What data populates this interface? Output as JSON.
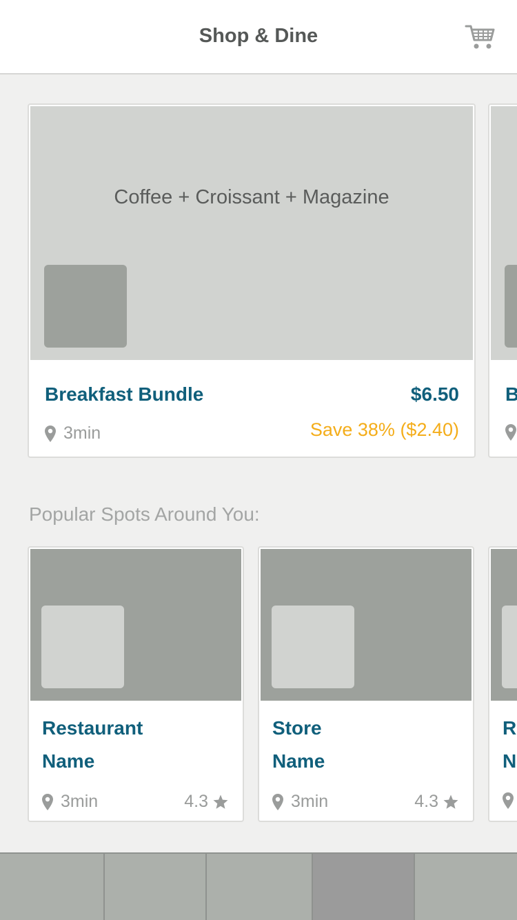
{
  "header": {
    "title": "Shop & Dine",
    "cart_icon": "cart-icon"
  },
  "bundles": [
    {
      "image_caption": "Coffee + Croissant + Magazine",
      "name": "Breakfast Bundle",
      "price": "$6.50",
      "savings": "Save 38% ($2.40)",
      "time": "3min"
    },
    {
      "image_caption": "",
      "name": "B",
      "price": "",
      "savings": "",
      "time": ""
    }
  ],
  "popular": {
    "label": "Popular Spots Around You:",
    "spots": [
      {
        "name_line1": "Restaurant",
        "name_line2": "Name",
        "time": "3min",
        "rating": "4.3"
      },
      {
        "name_line1": "Store",
        "name_line2": "Name",
        "time": "3min",
        "rating": "4.3"
      },
      {
        "name_line1": "Re",
        "name_line2": "N",
        "time": "",
        "rating": ""
      }
    ]
  },
  "tabbar": {
    "active_index": 3,
    "tab_count": 5
  },
  "colors": {
    "accent": "#105f7b",
    "savings": "#f4ad1a",
    "muted_text": "#9a9c9b",
    "placeholder_light": "#d1d3d0",
    "placeholder_dark": "#9da19c"
  },
  "icons": {
    "location": "map-pin-icon",
    "rating": "star-icon"
  }
}
